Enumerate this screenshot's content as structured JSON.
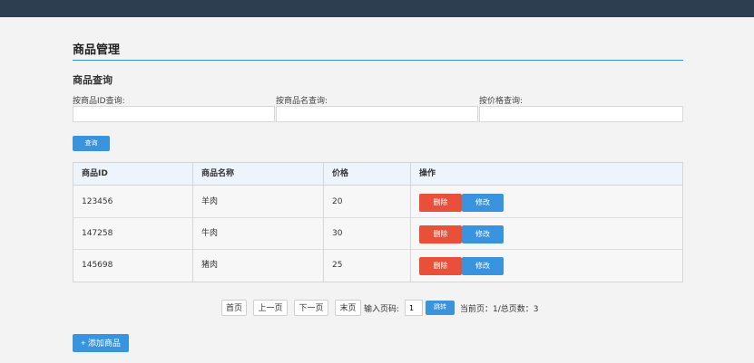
{
  "page": {
    "title": "商品管理"
  },
  "query": {
    "section_title": "商品查询",
    "id_label": "按商品ID查询:",
    "name_label": "按商品名查询:",
    "price_label": "按价格查询:",
    "id_value": "",
    "name_value": "",
    "price_value": "",
    "button_label": "查询"
  },
  "table": {
    "headers": [
      "商品ID",
      "商品名称",
      "价格",
      "操作"
    ],
    "rows": [
      {
        "id": "123456",
        "name": "羊肉",
        "price": "20"
      },
      {
        "id": "147258",
        "name": "牛肉",
        "price": "30"
      },
      {
        "id": "145698",
        "name": "猪肉",
        "price": "25"
      }
    ],
    "delete_label": "删除",
    "edit_label": "修改"
  },
  "pager": {
    "first": "首页",
    "prev": "上一页",
    "next": "下一页",
    "last": "末页",
    "input_label": "输入页码:",
    "page_value": "1",
    "jump_label": "跳转",
    "status": "当前页：1/总页数：3"
  },
  "add_label": "+ 添加商品",
  "colors": {
    "topbar": "#2c3e50",
    "primary": "#3a93dd",
    "danger": "#e8503a"
  }
}
